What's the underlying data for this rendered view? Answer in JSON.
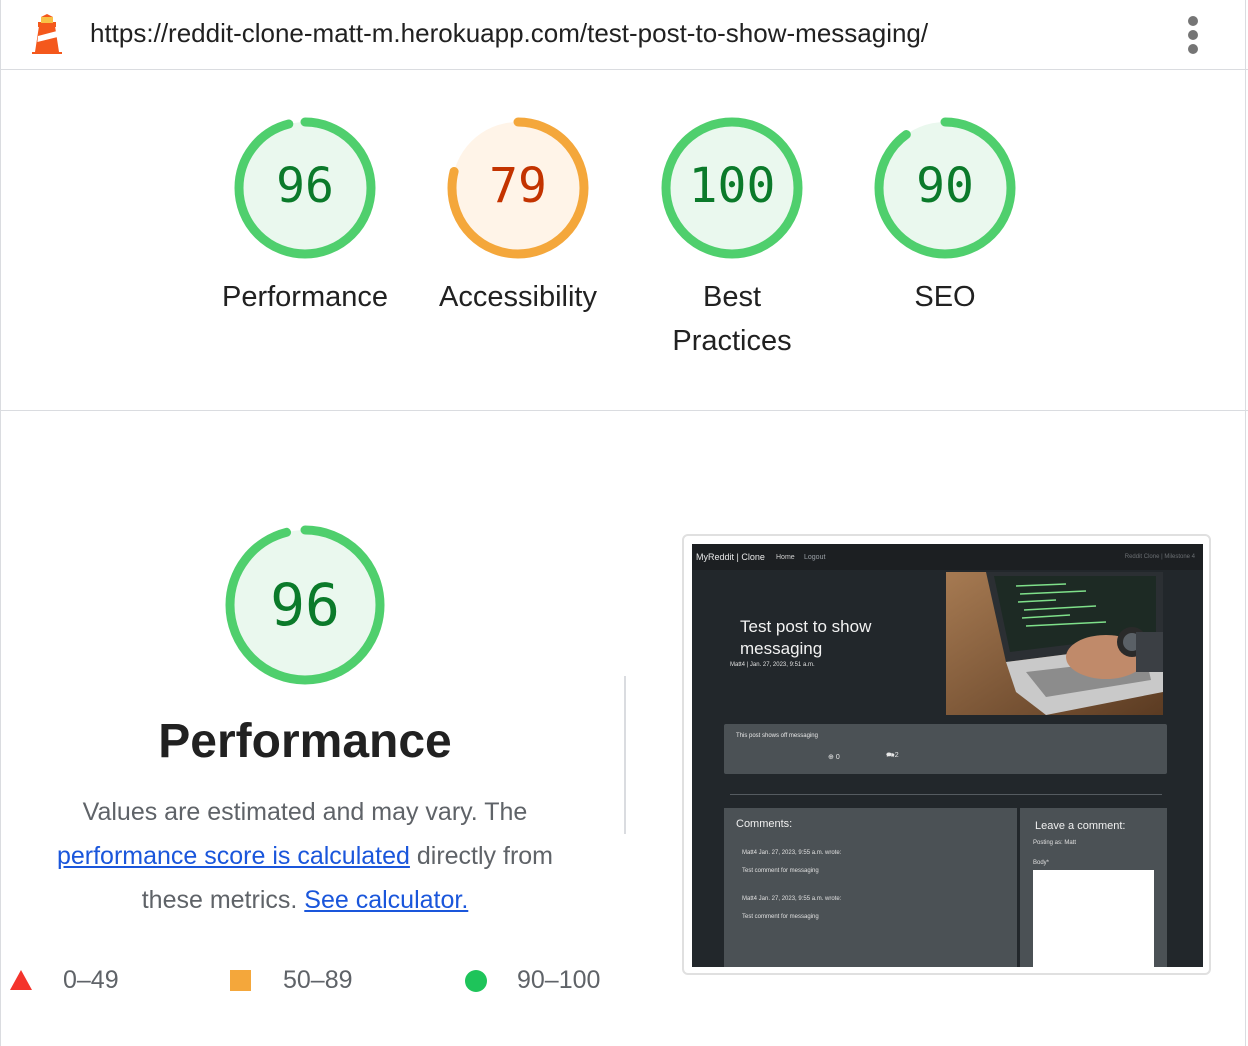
{
  "header": {
    "url": "https://reddit-clone-matt-m.herokuapp.com/test-post-to-show-messaging/",
    "menu_icon": "kebab-menu-icon",
    "logo_icon": "lighthouse-icon"
  },
  "gauges": [
    {
      "score": "96",
      "value": 96,
      "label": "Performance",
      "status": "pass"
    },
    {
      "score": "79",
      "value": 79,
      "label": "Accessibility",
      "status": "average"
    },
    {
      "score": "100",
      "value": 100,
      "label": "Best Practices",
      "status": "pass"
    },
    {
      "score": "90",
      "value": 90,
      "label": "SEO",
      "status": "pass"
    }
  ],
  "performance": {
    "score": "96",
    "value": 96,
    "title": "Performance",
    "desc_prefix": "Values are estimated and may vary. The ",
    "desc_link1": "performance score is calculated",
    "desc_mid": " directly from these metrics. ",
    "desc_link2": "See calculator."
  },
  "legend": [
    {
      "range": "0–49",
      "shape": "triangle",
      "color": "#f4342c"
    },
    {
      "range": "50–89",
      "shape": "square",
      "color": "#f4a73b"
    },
    {
      "range": "90–100",
      "shape": "circle",
      "color": "#1ec45a"
    }
  ],
  "colors": {
    "pass": "#0b7a2a",
    "pass_ring": "#4fcf6d",
    "pass_bg": "#eaf8ee",
    "average": "#c33300",
    "average_ring": "#f4a73b",
    "average_bg": "#fff4e8",
    "link": "#1a56db"
  },
  "thumbnail": {
    "brand": "MyReddit | Clone",
    "nav_home": "Home",
    "nav_logout": "Logout",
    "nav_right": "Reddit Clone | Milestone 4",
    "post_title": "Test post to show messaging",
    "post_meta": "Matt4 | Jan. 27, 2023, 9:51 a.m.",
    "post_body": "This post shows off messaging",
    "likes": "0",
    "comments_count": "2",
    "comments_title": "Comments:",
    "comments": [
      {
        "meta": "Matt4 Jan. 27, 2023, 9:55 a.m. wrote:",
        "body": "Test comment for messaging"
      },
      {
        "meta": "Matt4 Jan. 27, 2023, 9:55 a.m. wrote:",
        "body": "Test comment for messaging"
      }
    ],
    "leave_title": "Leave a comment:",
    "posting_as": "Posting as: Matt",
    "body_label": "Body*"
  }
}
